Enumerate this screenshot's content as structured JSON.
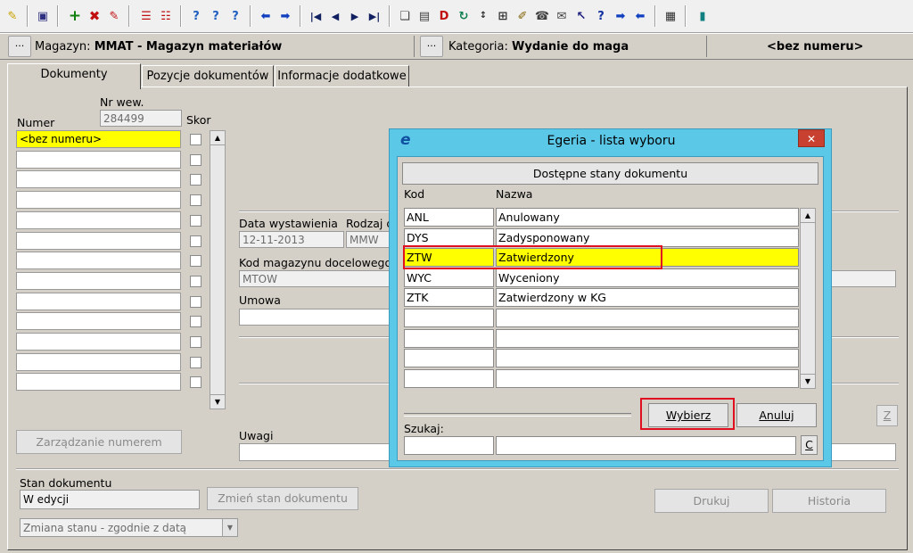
{
  "toolbar": {
    "icons": [
      "pin-icon",
      "save-icon",
      "add-icon",
      "delete-icon",
      "edit-icon",
      "split-icon",
      "merge-icon",
      "help-find-icon",
      "help-question-icon",
      "help-context-icon",
      "back-arrow-icon",
      "forward-arrow-icon",
      "first-record-icon",
      "prev-record-icon",
      "next-record-icon",
      "last-record-icon",
      "copy-icon",
      "print-preview-icon",
      "filter-icon",
      "refresh-icon",
      "sort-icon",
      "tree-icon",
      "brush-icon",
      "phone-icon",
      "mail-icon",
      "pointer-help-icon",
      "question-icon",
      "right-arrow-icon",
      "left-arrow-icon",
      "report-icon",
      "exit-door-icon"
    ]
  },
  "header": {
    "magazyn_label": "Magazyn:",
    "magazyn_value": "MMAT - Magazyn materiałów",
    "kategoria_label": "Kategoria:",
    "kategoria_value": "Wydanie do maga",
    "numer_value": "<bez numeru>",
    "ellipsis": "..."
  },
  "tabs": [
    {
      "label": "Dokumenty"
    },
    {
      "label": "Pozycje dokumentów"
    },
    {
      "label": "Informacje dodatkowe"
    }
  ],
  "form": {
    "nr_wew_label": "Nr wew.",
    "nr_wew_value": "284499",
    "numer_label": "Numer",
    "skor_label": "Skor",
    "numer_first": "<bez numeru>",
    "data_wystawienia_label": "Data wystawienia",
    "data_wystawienia_value": "12-11-2013",
    "rodzaj_label": "Rodzaj d",
    "rodzaj_value": "MMW",
    "kod_magazynu_label": "Kod magazynu docelowego",
    "kod_magazynu_value": "MTOW",
    "umowa_label": "Umowa",
    "uwagi_label": "Uwagi",
    "zarzadzanie_button": "Zarządzanie numerem",
    "stan_label": "Stan dokumentu",
    "stan_value": "W edycji",
    "zmien_stan_button": "Zmień stan dokumentu",
    "zmiana_select": "Zmiana stanu - zgodnie z datą",
    "drukuj_button": "Drukuj",
    "historia_button": "Historia",
    "z_button": "Z"
  },
  "dialog": {
    "logo": "e",
    "title": "Egeria - lista wyboru",
    "close": "✕",
    "header_button": "Dostępne stany dokumentu",
    "col_kod": "Kod",
    "col_nazwa": "Nazwa",
    "rows": [
      {
        "kod": "ANL",
        "nazwa": "Anulowany"
      },
      {
        "kod": "DYS",
        "nazwa": "Zadysponowany"
      },
      {
        "kod": "ZTW",
        "nazwa": "Zatwierdzony"
      },
      {
        "kod": "WYC",
        "nazwa": "Wyceniony"
      },
      {
        "kod": "ZTK",
        "nazwa": "Zatwierdzony w KG"
      }
    ],
    "selected_index": 2,
    "szukaj_label": "Szukaj:",
    "wybierz_button": "Wybierz",
    "anuluj_button": "Anuluj",
    "c_button": "C"
  },
  "colors": {
    "selection": "#ffff00",
    "dialog_frame": "#5cc8e8",
    "highlight_box": "#e01020"
  }
}
